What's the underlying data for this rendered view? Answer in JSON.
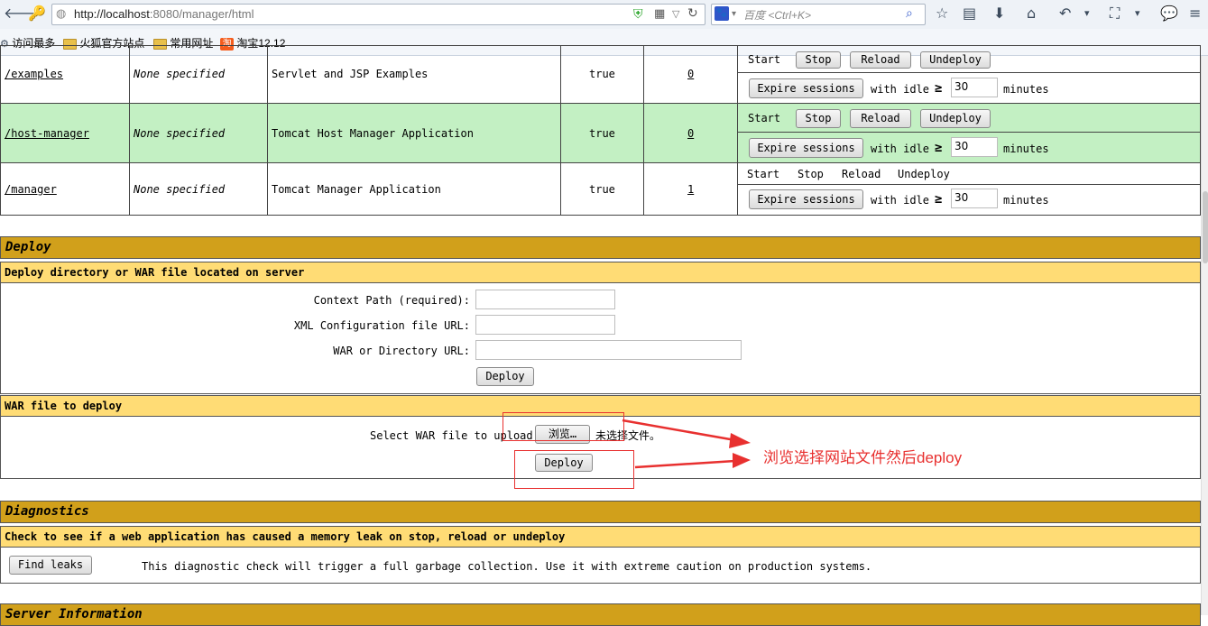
{
  "browser": {
    "url_host": "http://localhost",
    "url_path": ":8080/manager/html",
    "search_placeholder": "百度 <Ctrl+K>",
    "bookmarks": [
      "访问最多",
      "火狐官方站点",
      "常用网址",
      "淘宝12.12"
    ]
  },
  "apps": [
    {
      "path": "/examples",
      "version": "None specified",
      "display": "Servlet and JSP Examples",
      "running": "true",
      "sessions": "0",
      "highlight": false
    },
    {
      "path": "/host-manager",
      "version": "None specified",
      "display": "Tomcat Host Manager Application",
      "running": "true",
      "sessions": "0",
      "highlight": true
    },
    {
      "path": "/manager",
      "version": "None specified",
      "display": "Tomcat Manager Application",
      "running": "true",
      "sessions": "1",
      "highlight": false
    }
  ],
  "commands": {
    "start": "Start",
    "stop": "Stop",
    "reload": "Reload",
    "undeploy": "Undeploy",
    "expire": "Expire sessions",
    "with_idle": "with idle",
    "gte": "≥",
    "idle_value": "30",
    "minutes": "minutes"
  },
  "deploy": {
    "header": "Deploy",
    "server_sub": "Deploy directory or WAR file located on server",
    "context_label": "Context Path (required):",
    "xml_label": "XML Configuration file URL:",
    "war_dir_label": "WAR or Directory URL:",
    "deploy_btn": "Deploy",
    "war_sub": "WAR file to deploy",
    "select_label": "Select WAR file to upload",
    "browse_btn": "浏览…",
    "no_file": "未选择文件。",
    "deploy_btn2": "Deploy"
  },
  "annotation": {
    "text": "浏览选择网站文件然后deploy",
    "color": "#e8302f"
  },
  "diagnostics": {
    "header": "Diagnostics",
    "sub": "Check to see if a web application has caused a memory leak on stop, reload or undeploy",
    "find_leaks": "Find leaks",
    "note": "This diagnostic check will trigger a full garbage collection. Use it with extreme caution on production systems."
  },
  "server_info": {
    "header": "Server Information"
  },
  "colors": {
    "highlight_row": "#c3f0c3",
    "section_header": "#d1a01b",
    "sub_header": "#ffdc75"
  }
}
